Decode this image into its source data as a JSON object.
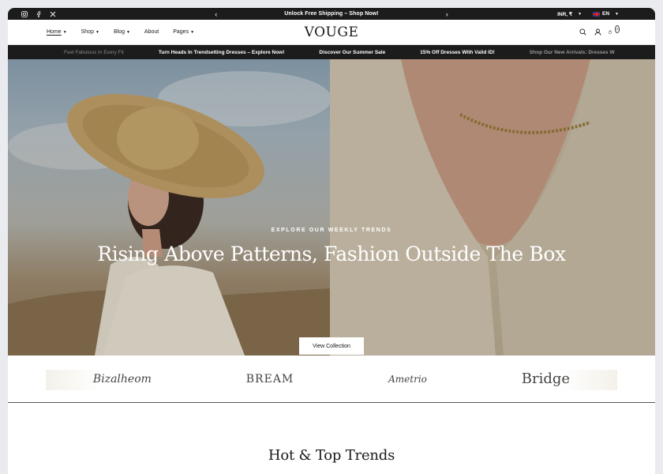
{
  "topbar": {
    "promo": "Unlock Free Shipping – Shop Now!",
    "currency": "INR, ₹",
    "language": "EN",
    "socials": [
      "instagram-icon",
      "facebook-icon",
      "x-icon"
    ]
  },
  "nav": {
    "logo": "VOUGE",
    "menu": [
      {
        "label": "Home",
        "has_dropdown": true
      },
      {
        "label": "Shop",
        "has_dropdown": true
      },
      {
        "label": "Blog",
        "has_dropdown": true
      },
      {
        "label": "About",
        "has_dropdown": false
      },
      {
        "label": "Pages",
        "has_dropdown": true
      }
    ],
    "cart_count": "0"
  },
  "marquee": [
    "Feel Fabulous In Every Fit",
    "Turn Heads In Trendsetting Dresses – Explore Now!",
    "Discover Our Summer Sale",
    "15% Off Dresses With Valid ID!",
    "Shop Our New Arrivals: Dresses W"
  ],
  "hero": {
    "eyebrow": "EXPLORE OUR WEEKLY TRENDS",
    "headline": "Rising Above Patterns, Fashion Outside The Box",
    "cta": "View Collection"
  },
  "brands": [
    "Bizalheom",
    "BREAM",
    "Ametrio",
    "Bridge"
  ],
  "section": {
    "title": "Hot & Top Trends"
  }
}
